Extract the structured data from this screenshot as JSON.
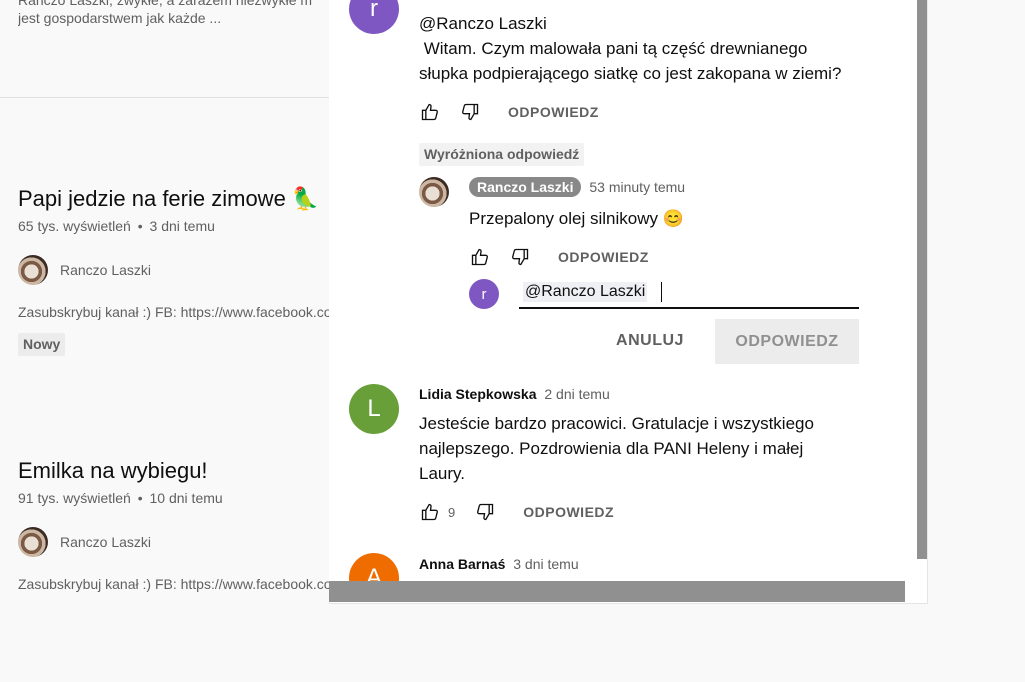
{
  "left": {
    "top_snippet_line1": "Ranczo Laszki, zwykłe, a zarazem niezwykłe m",
    "top_snippet_line2": "jest gospodarstwem jak każde ...",
    "videos": [
      {
        "title": "Papi jedzie na ferie zimowe 🦜",
        "views": "65 tys. wyświetleń",
        "age": "3 dni temu",
        "channel": "Ranczo Laszki",
        "description": "Zasubskrybuj kanał :) FB: https://www.facebook.com",
        "badge": "Nowy"
      },
      {
        "title": "Emilka na wybiegu!",
        "views": "91 tys. wyświetleń",
        "age": "10 dni temu",
        "channel": "Ranczo Laszki",
        "description": "Zasubskrybuj kanał :) FB: https://www.facebook.com"
      }
    ],
    "dot": "•"
  },
  "comments": {
    "first": {
      "avatar_letter": "r",
      "avatar_color": "#7e57c2",
      "text_line1": "@Ranczo Laszki",
      "text_line2": " Witam. Czym malowała pani tą część drewnianego",
      "text_line3": "słupka podpierającego siatkę co jest zakopana w ziemi?",
      "reply_label": "ODPOWIEDZ"
    },
    "pinned_label": "Wyróżniona odpowiedź",
    "owner_reply": {
      "author": "Ranczo Laszki",
      "time": "53 minuty temu",
      "text": "Przepalony olej silnikowy 😊",
      "reply_label": "ODPOWIEDZ"
    },
    "reply_box": {
      "avatar_letter": "r",
      "avatar_color": "#7e57c2",
      "value": "@Ranczo Laszki",
      "cancel_label": "ANULUJ",
      "submit_label": "ODPOWIEDZ"
    },
    "lidia": {
      "avatar_letter": "L",
      "avatar_color": "#689f38",
      "author": "Lidia Stepkowska",
      "time": "2 dni temu",
      "text_line1": "Jesteście bardzo pracowici. Gratulacje i wszystkiego",
      "text_line2": "najlepszego. Pozdrowienia dla PANI Heleny i małej",
      "text_line3": "Laury.",
      "likes": "9",
      "reply_label": "ODPOWIEDZ"
    },
    "anna": {
      "avatar_letter": "A",
      "avatar_color": "#ef6c00",
      "author": "Anna Barnaś",
      "time": "3 dni temu"
    }
  }
}
